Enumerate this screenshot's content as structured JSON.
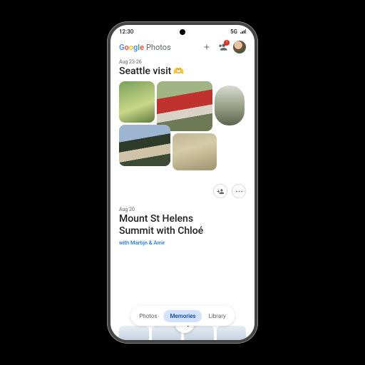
{
  "status": {
    "time": "12:30",
    "network": "5G"
  },
  "brand": {
    "g": "Google",
    "product": "Photos"
  },
  "header": {
    "share_badge": "1"
  },
  "memory1": {
    "date": "Aug 23-26",
    "title": "Seattle visit",
    "emoji": "🫶"
  },
  "memory2": {
    "date": "Aug 20",
    "title_l1": "Mount St Helens",
    "title_l2": "Summit with Chloé",
    "subtitle": "with Martijn & Amir"
  },
  "nav": {
    "photos": "Photos",
    "memories": "Memories",
    "library": "Library"
  }
}
